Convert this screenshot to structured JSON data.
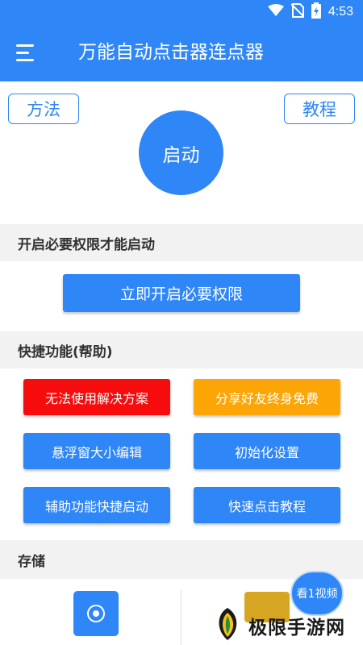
{
  "status_bar": {
    "time": "4:53",
    "icons": [
      "wifi-icon",
      "no-sim-icon",
      "battery-charging-icon"
    ]
  },
  "app_bar": {
    "menu_icon": "menu-icon",
    "title": "万能自动点击器连点器"
  },
  "top": {
    "method_label": "方法",
    "tutorial_label": "教程",
    "start_label": "启动"
  },
  "permission_section": {
    "header": "开启必要权限才能启动",
    "button_label": "立即开启必要权限"
  },
  "quick_section": {
    "header": "快捷功能(帮助)",
    "buttons": [
      {
        "label": "无法使用解决方案",
        "color": "#f60c0c"
      },
      {
        "label": "分享好友终身免费",
        "color": "#fba606"
      },
      {
        "label": "悬浮窗大小编辑",
        "color": "#2f86f6"
      },
      {
        "label": "初始化设置",
        "color": "#2f86f6"
      },
      {
        "label": "辅助功能快捷启动",
        "color": "#2f86f6"
      },
      {
        "label": "快速点击教程",
        "color": "#2f86f6"
      }
    ]
  },
  "storage_section": {
    "header": "存储",
    "item_icon": "record-icon"
  },
  "video_badge": {
    "label": "看1视频"
  },
  "watermark": {
    "text": "极限手游网",
    "logo_icon": "leaf-logo-icon"
  },
  "colors": {
    "primary": "#2f86f6",
    "danger": "#f60c0c",
    "warning": "#fba606",
    "section_bg": "#f2f2f2"
  }
}
